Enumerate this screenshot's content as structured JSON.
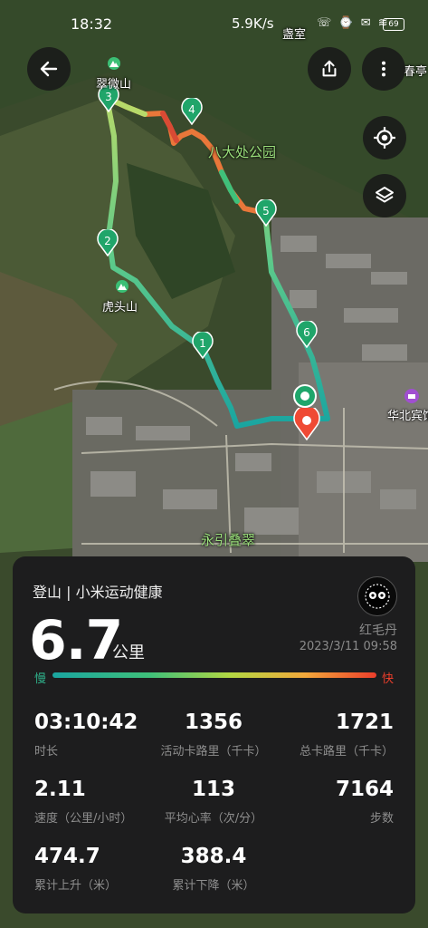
{
  "status_bar": {
    "time": "18:32",
    "net_speed": "5.9K/s",
    "icons": "☏ ⌚ ✉ ≋",
    "battery": "69"
  },
  "map": {
    "labels": {
      "cuiwei": "翠微山",
      "badachu": "八大处公园",
      "hutou": "虎头山",
      "yongyin": "永引叠翠",
      "huabei": "华北宾馆",
      "shishi": "盏室",
      "chunting": "春亭"
    },
    "markers": [
      "1",
      "2",
      "3",
      "4",
      "5",
      "6"
    ],
    "colors": {
      "route_slow": "#1aa5a0",
      "route_mid": "#6ed07a",
      "route_fast": "#ec3e2b"
    }
  },
  "toolbar": {
    "back_icon": "arrow-left-icon",
    "share_icon": "share-icon",
    "more_icon": "more-vertical-icon",
    "locate_icon": "crosshair-icon",
    "layers_icon": "layers-icon"
  },
  "summary": {
    "title": "登山 | 小米运动健康",
    "distance": "6.7",
    "unit": "公里",
    "username": "红毛丹",
    "datetime": "2023/3/11 09:58",
    "speed_slow": "慢",
    "speed_fast": "快"
  },
  "stats": [
    {
      "value": "03:10:42",
      "label": "时长"
    },
    {
      "value": "1356",
      "label": "活动卡路里（千卡）"
    },
    {
      "value": "1721",
      "label": "总卡路里（千卡）"
    },
    {
      "value": "2.11",
      "label": "速度（公里/小时）"
    },
    {
      "value": "113",
      "label": "平均心率（次/分）"
    },
    {
      "value": "7164",
      "label": "步数"
    },
    {
      "value": "474.7",
      "label": "累计上升（米）"
    },
    {
      "value": "388.4",
      "label": "累计下降（米）"
    }
  ]
}
